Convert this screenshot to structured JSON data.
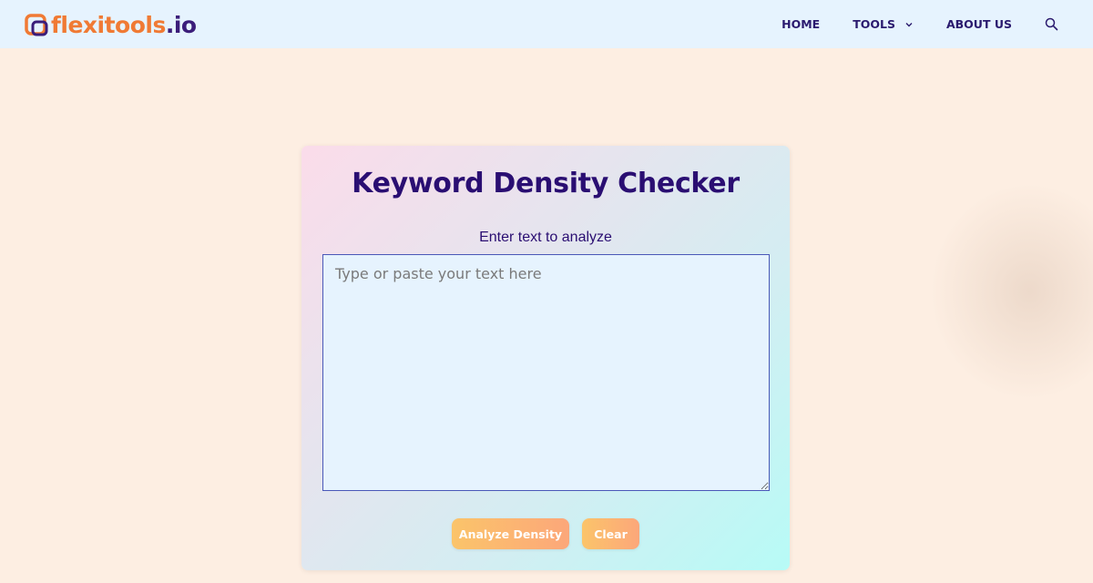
{
  "brand": {
    "name": "flexitools",
    "tld": ".io",
    "colors": {
      "primary": "#f07a34",
      "secondary": "#3b1d7a"
    }
  },
  "nav": {
    "items": [
      {
        "label": "HOME"
      },
      {
        "label": "TOOLS"
      },
      {
        "label": "ABOUT US"
      }
    ],
    "icons": {
      "tools_dropdown": "chevron-down-icon",
      "search": "search-icon"
    }
  },
  "tool": {
    "title": "Keyword Density Checker",
    "field_label": "Enter text to analyze",
    "textarea": {
      "value": "",
      "placeholder": "Type or paste your text here"
    },
    "buttons": {
      "analyze": "Analyze Density",
      "clear": "Clear"
    }
  },
  "colors": {
    "header_bg": "#e6f3fe",
    "page_bg": "#fdeee2",
    "title": "#2a0e72",
    "button_gradient": [
      "#fbc46a",
      "#fca77a"
    ]
  }
}
